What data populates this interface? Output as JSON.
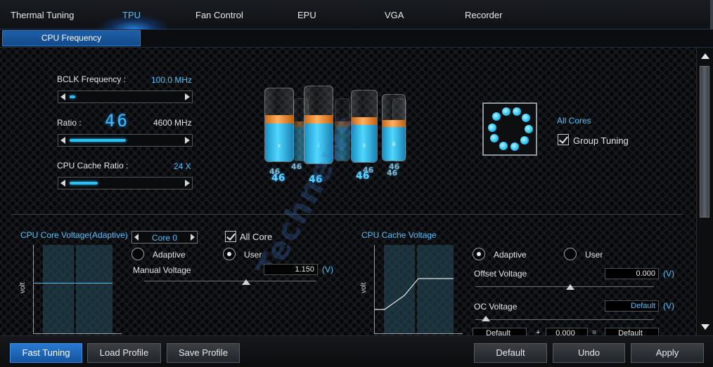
{
  "tabs": [
    {
      "label": "Thermal Tuning",
      "active": false
    },
    {
      "label": "TPU",
      "active": true
    },
    {
      "label": "Fan Control",
      "active": false
    },
    {
      "label": "EPU",
      "active": false
    },
    {
      "label": "VGA",
      "active": false
    },
    {
      "label": "Recorder",
      "active": false
    }
  ],
  "subtab": {
    "label": "CPU Frequency"
  },
  "freq": {
    "bclk_label": "BCLK Frequency :",
    "bclk_value": "100.0  MHz",
    "ratio_label": "Ratio :",
    "ratio_big": "46",
    "ratio_mhz": "4600  MHz",
    "cache_label": "CPU Cache Ratio :",
    "cache_value": "24  X",
    "bclk_level": 0.05,
    "ratio_level": 0.5,
    "cache_level": 0.25
  },
  "cores": {
    "numbers": [
      "46",
      "46",
      "46",
      "46"
    ],
    "numbers_back": [
      "46",
      "46",
      "46",
      "46"
    ],
    "glyphs": [
      "x",
      "i",
      "ii",
      "iii"
    ],
    "all_cores": "All Cores",
    "group_tuning": "Group Tuning",
    "group_tuning_checked": true
  },
  "core_voltage": {
    "title": "CPU Core Voltage(Adaptive)",
    "core_select": "Core 0",
    "all_core": "All Core",
    "all_core_checked": true,
    "adaptive": "Adaptive",
    "user": "User",
    "selected": "User",
    "manual_label": "Manual Voltage",
    "manual_value": "1.150",
    "unit": "(V)",
    "axis": "volt"
  },
  "cache_voltage": {
    "title": "CPU Cache Voltage",
    "adaptive": "Adaptive",
    "user": "User",
    "selected": "Adaptive",
    "offset_label": "Offset Voltage",
    "offset_value": "0.000",
    "oc_label": "OC Voltage",
    "oc_value": "Default",
    "unit": "(V)",
    "axis": "volt",
    "bottom_row": [
      "Default",
      "+",
      "0.000",
      "=",
      "Default"
    ]
  },
  "watermark": "Technews",
  "buttons": {
    "fast_tuning": "Fast Tuning",
    "load_profile": "Load Profile",
    "save_profile": "Save Profile",
    "default": "Default",
    "undo": "Undo",
    "apply": "Apply"
  },
  "colors": {
    "accent": "#4fc3ff",
    "active_button": "#1e6fc8",
    "battery_blue": "#3ccaf5",
    "battery_orange": "#ff9a3c"
  }
}
